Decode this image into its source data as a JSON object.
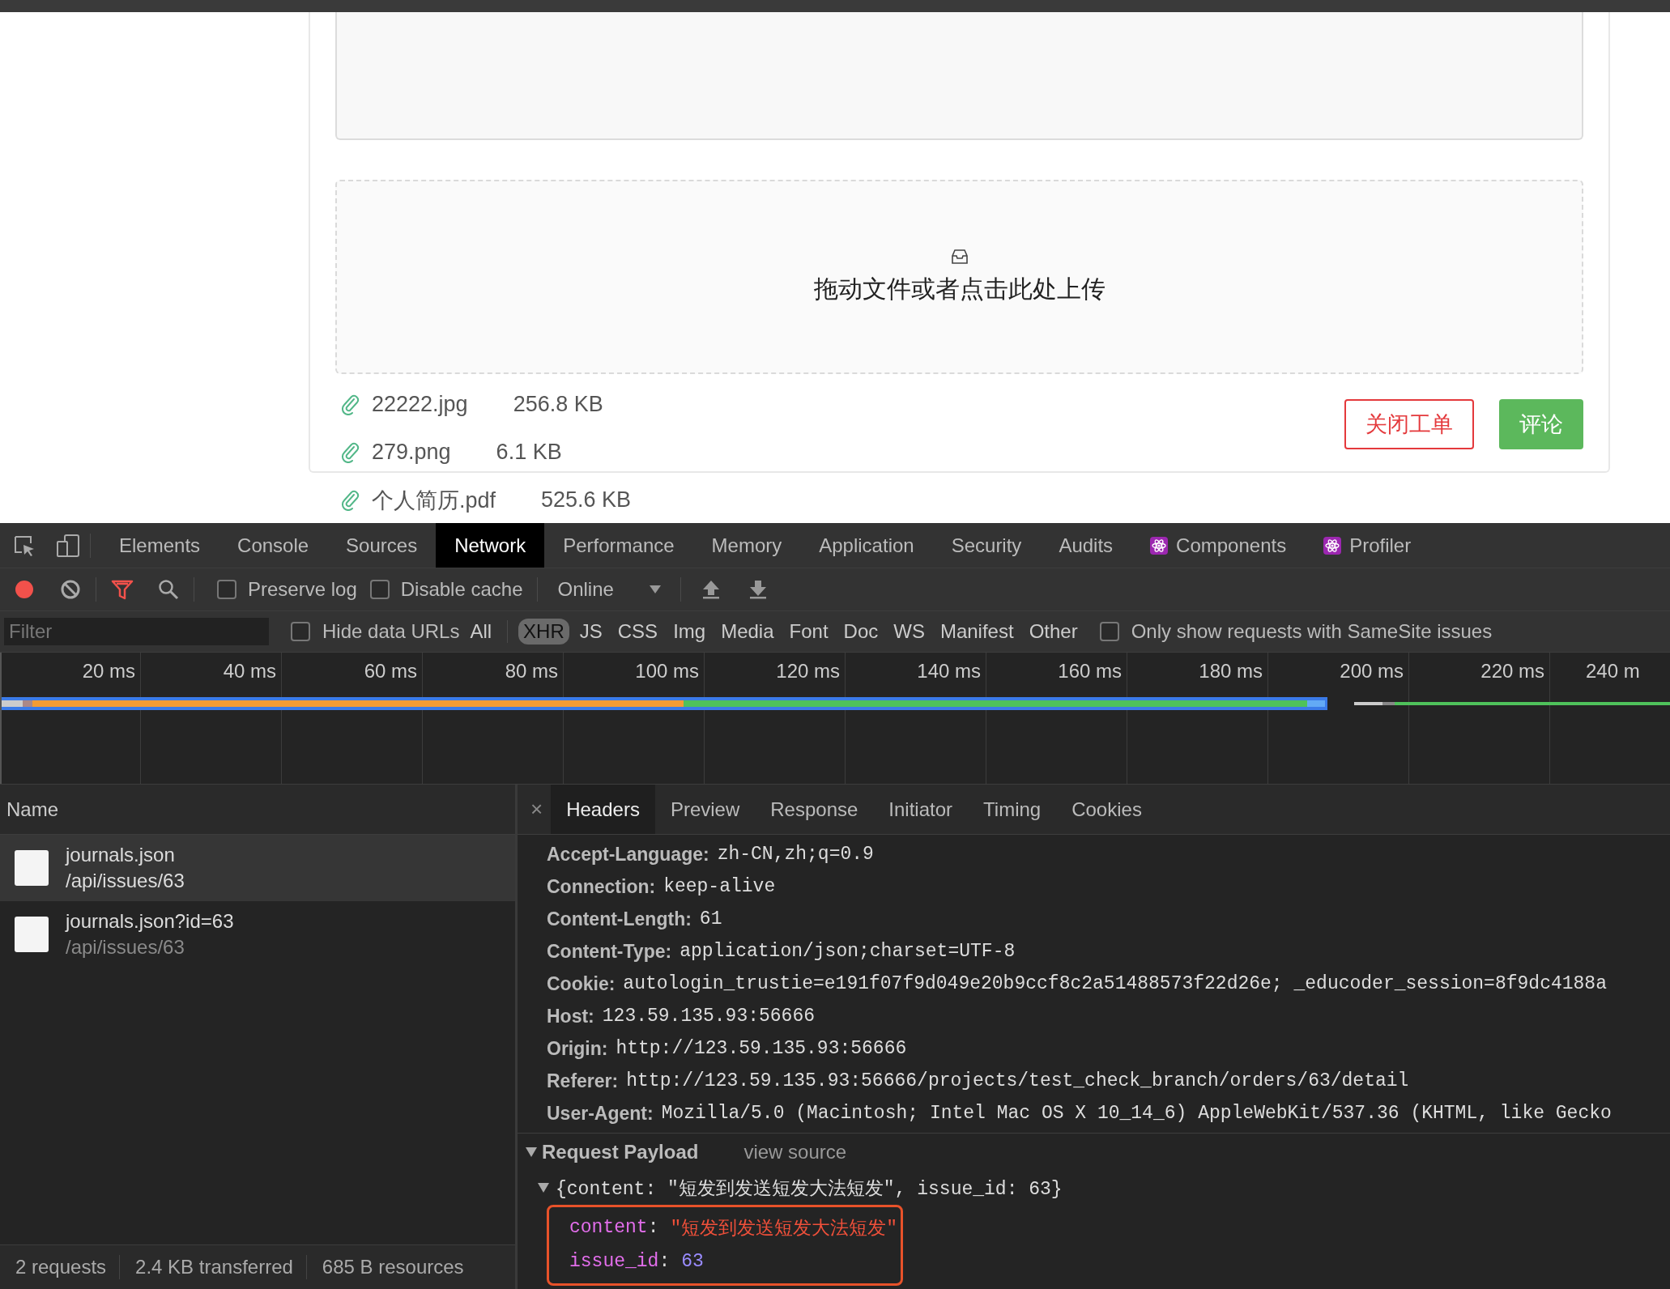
{
  "page": {
    "upload": {
      "hint": "拖动文件或者点击此处上传"
    },
    "attachments": [
      {
        "name": "22222.jpg",
        "size": "256.8 KB"
      },
      {
        "name": "279.png",
        "size": "6.1 KB"
      },
      {
        "name": "个人简历.pdf",
        "size": "525.6 KB"
      }
    ],
    "buttons": [
      {
        "label": "关闭工单",
        "kind": "outline"
      },
      {
        "label": "评论",
        "kind": "primary"
      }
    ]
  },
  "devtools": {
    "panels": [
      {
        "label": "Elements",
        "selected": false,
        "kind": "plain"
      },
      {
        "label": "Console",
        "selected": false,
        "kind": "plain"
      },
      {
        "label": "Sources",
        "selected": false,
        "kind": "plain"
      },
      {
        "label": "Network",
        "selected": true,
        "kind": "plain"
      },
      {
        "label": "Performance",
        "selected": false,
        "kind": "plain"
      },
      {
        "label": "Memory",
        "selected": false,
        "kind": "plain"
      },
      {
        "label": "Application",
        "selected": false,
        "kind": "plain"
      },
      {
        "label": "Security",
        "selected": false,
        "kind": "plain"
      },
      {
        "label": "Audits",
        "selected": false,
        "kind": "plain"
      },
      {
        "label": "Components",
        "selected": false,
        "kind": "react"
      },
      {
        "label": "Profiler",
        "selected": false,
        "kind": "react"
      }
    ],
    "toolbar": {
      "recording": true,
      "preserve_log": {
        "label": "Preserve log",
        "checked": false
      },
      "disable_cache": {
        "label": "Disable cache",
        "checked": false
      },
      "throttling": "Online"
    },
    "filter": {
      "placeholder": "Filter",
      "hide_data_urls": {
        "label": "Hide data URLs",
        "checked": false
      },
      "types": [
        {
          "label": "All",
          "selected": false
        },
        {
          "label": "XHR",
          "selected": true
        },
        {
          "label": "JS",
          "selected": false
        },
        {
          "label": "CSS",
          "selected": false
        },
        {
          "label": "Img",
          "selected": false
        },
        {
          "label": "Media",
          "selected": false
        },
        {
          "label": "Font",
          "selected": false
        },
        {
          "label": "Doc",
          "selected": false
        },
        {
          "label": "WS",
          "selected": false
        },
        {
          "label": "Manifest",
          "selected": false
        },
        {
          "label": "Other",
          "selected": false
        }
      ],
      "samesite": {
        "label": "Only show requests with SameSite issues",
        "checked": false
      }
    },
    "timeline": {
      "ticks": [
        "20 ms",
        "40 ms",
        "60 ms",
        "80 ms",
        "100 ms",
        "120 ms",
        "140 ms",
        "160 ms",
        "180 ms",
        "200 ms",
        "220 ms",
        "240 m"
      ]
    },
    "requests": {
      "header": "Name",
      "rows": [
        {
          "name": "journals.json",
          "path": "/api/issues/63",
          "selected": true
        },
        {
          "name": "journals.json?id=63",
          "path": "/api/issues/63",
          "selected": false
        }
      ]
    },
    "status_bar": [
      "2 requests",
      "2.4 KB transferred",
      "685 B resources"
    ],
    "details": {
      "close": "×",
      "tabs": [
        {
          "label": "Headers",
          "selected": true
        },
        {
          "label": "Preview",
          "selected": false
        },
        {
          "label": "Response",
          "selected": false
        },
        {
          "label": "Initiator",
          "selected": false
        },
        {
          "label": "Timing",
          "selected": false
        },
        {
          "label": "Cookies",
          "selected": false
        }
      ],
      "headers": [
        {
          "name": "Accept-Language:",
          "value": "zh-CN,zh;q=0.9"
        },
        {
          "name": "Connection:",
          "value": "keep-alive"
        },
        {
          "name": "Content-Length:",
          "value": "61"
        },
        {
          "name": "Content-Type:",
          "value": "application/json;charset=UTF-8"
        },
        {
          "name": "Cookie:",
          "value": "autologin_trustie=e191f07f9d049e20b9ccf8c2a51488573f22d26e; _educoder_session=8f9dc4188a"
        },
        {
          "name": "Host:",
          "value": "123.59.135.93:56666"
        },
        {
          "name": "Origin:",
          "value": "http://123.59.135.93:56666"
        },
        {
          "name": "Referer:",
          "value": "http://123.59.135.93:56666/projects/test_check_branch/orders/63/detail"
        },
        {
          "name": "User-Agent:",
          "value": "Mozilla/5.0 (Macintosh; Intel Mac OS X 10_14_6) AppleWebKit/537.36 (KHTML, like Gecko"
        }
      ],
      "payload": {
        "title": "Request Payload",
        "view_source": "view source",
        "expanded": true,
        "summary": "{content: \"短发到发送短发大法短发\", issue_id: 63}",
        "fields": [
          {
            "key": "content",
            "sep": ":",
            "value": "\"短发到发送短发大法短发\"",
            "kind": "string"
          },
          {
            "key": "issue_id",
            "sep": ":",
            "value": "63",
            "kind": "number"
          }
        ]
      }
    }
  }
}
